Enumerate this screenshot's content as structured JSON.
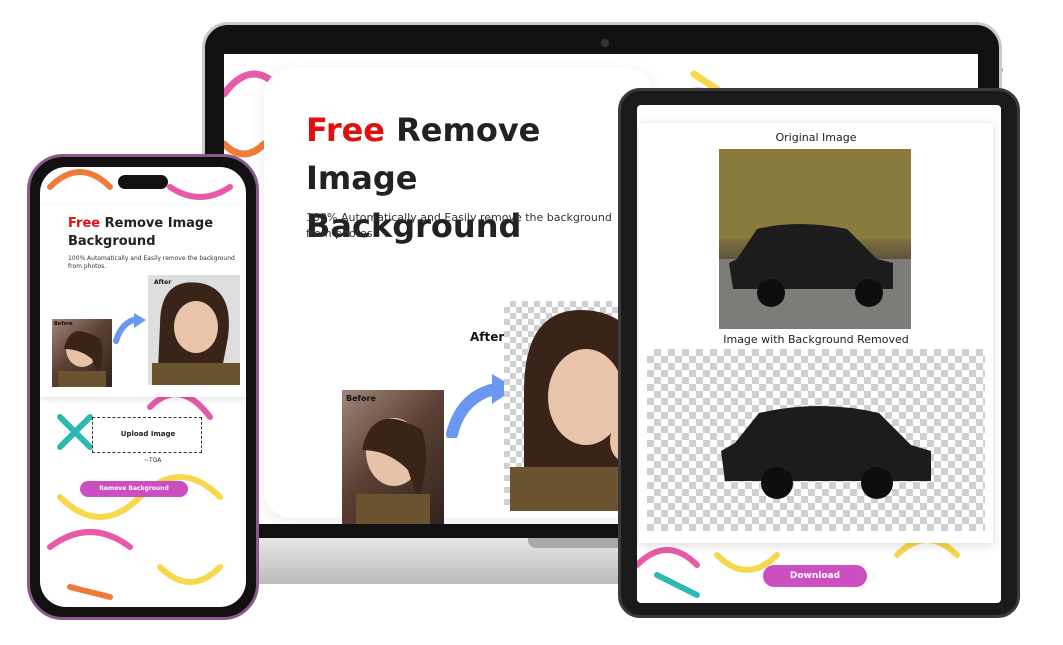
{
  "laptop": {
    "title_highlight": "Free",
    "title_rest": "Remove Image Background",
    "subtitle": "100% Automatically and Easily remove the background from photos.",
    "before_label": "Before",
    "after_label": "After"
  },
  "tablet": {
    "original_heading": "Original Image",
    "removed_heading": "Image with Background Removed",
    "download_label": "Download"
  },
  "phone": {
    "title_highlight": "Free",
    "title_rest": "Remove Image Background",
    "subtitle": "100% Automatically and Easily remove the background from photos.",
    "before_label": "Before",
    "after_label": "After",
    "upload_label": "Upload Image",
    "logo_text": "~TOA",
    "remove_label": "Remove Background"
  },
  "colors": {
    "accent_red": "#e01010",
    "button_pink": "#cc4fc2",
    "squiggle_colors": [
      "#e85aa8",
      "#f6d84a",
      "#2bb9b0",
      "#f07a3a",
      "#9bd8d0"
    ]
  }
}
